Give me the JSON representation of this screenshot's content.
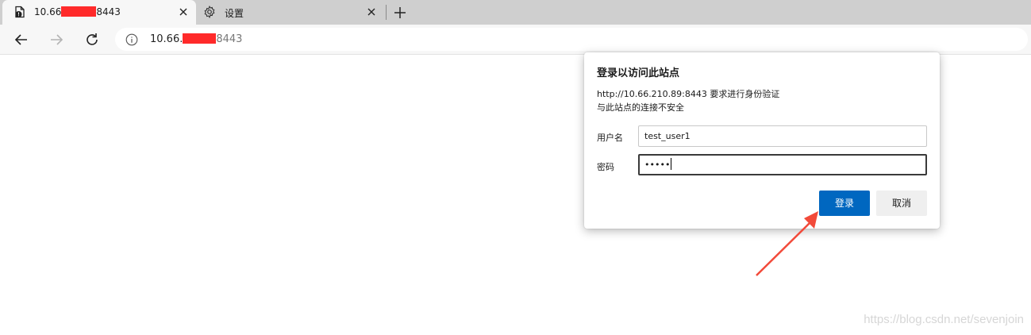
{
  "tabs": [
    {
      "title_prefix": "10.66",
      "title_suffix": "8443",
      "icon": "page-warning-icon",
      "active": true
    },
    {
      "title": "设置",
      "icon": "gear-icon",
      "active": false
    }
  ],
  "toolbar": {
    "url_prefix": "10.66.",
    "url_suffix": "8443"
  },
  "dialog": {
    "title": "登录以访问此站点",
    "message_line1": "http://10.66.210.89:8443 要求进行身份验证",
    "message_line2": "与此站点的连接不安全",
    "username_label": "用户名",
    "username_value": "test_user1",
    "password_label": "密码",
    "password_value": "•••••",
    "login_button": "登录",
    "cancel_button": "取消"
  },
  "watermark": "https://blog.csdn.net/sevenjoin",
  "colors": {
    "primary_button": "#0067c0",
    "annotation_arrow": "#f24a3a",
    "redaction": "#ff2a2a"
  }
}
